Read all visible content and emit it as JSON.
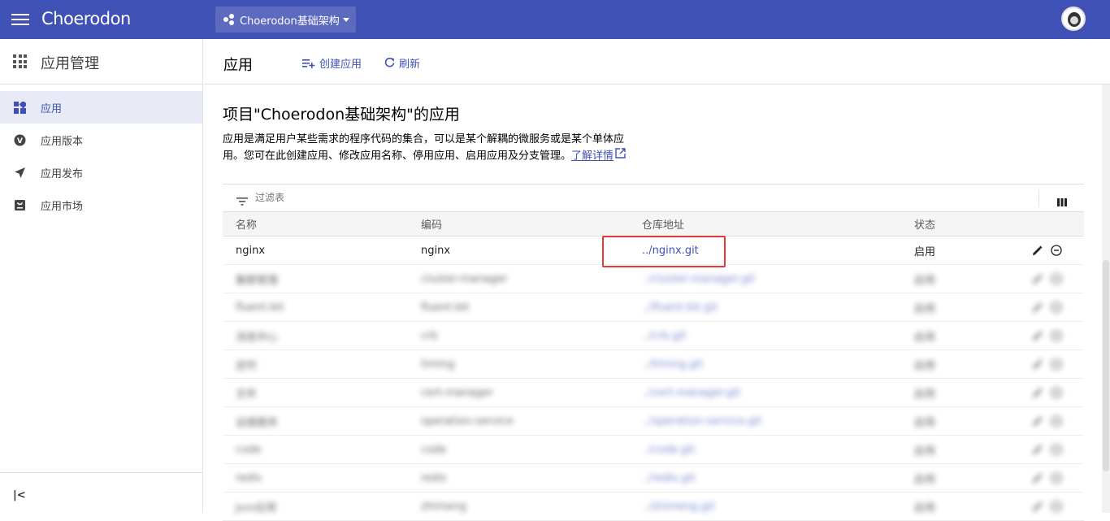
{
  "topbar": {
    "logo": "Choerodon",
    "project": "Choerodon基础架构"
  },
  "sidebar": {
    "title": "应用管理",
    "items": [
      {
        "label": "应用",
        "icon": "dashboard-icon",
        "active": true
      },
      {
        "label": "应用版本",
        "icon": "version-icon",
        "active": false
      },
      {
        "label": "应用发布",
        "icon": "send-icon",
        "active": false
      },
      {
        "label": "应用市场",
        "icon": "store-icon",
        "active": false
      }
    ]
  },
  "header": {
    "title": "应用",
    "create_label": "创建应用",
    "refresh_label": "刷新"
  },
  "main": {
    "heading": "项目\"Choerodon基础架构\"的应用",
    "description": "应用是满足用户某些需求的程序代码的集合，可以是某个解耦的微服务或是某个单体应用。您可在此创建应用、修改应用名称、停用应用、启用应用及分支管理。",
    "learn_more": "了解详情"
  },
  "filter": {
    "placeholder": "过滤表"
  },
  "table": {
    "columns": [
      "名称",
      "编码",
      "仓库地址",
      "状态"
    ],
    "rows": [
      {
        "name": "nginx",
        "code": "nginx",
        "repo": "../nginx.git",
        "status": "启用",
        "blurred": false
      },
      {
        "name": "集群管理",
        "code": "cluster-manager",
        "repo": "../cluster-manager.git",
        "status": "启用",
        "blurred": true
      },
      {
        "name": "fluent-bit",
        "code": "fluent-bit",
        "repo": "../fluent-bit.git",
        "status": "启用",
        "blurred": true
      },
      {
        "name": "消息中心",
        "code": "crb",
        "repo": "../crb.git",
        "status": "启用",
        "blurred": true
      },
      {
        "name": "定时",
        "code": "timing",
        "repo": "../timing.git",
        "status": "启用",
        "blurred": true
      },
      {
        "name": "文件",
        "code": "cert-manager",
        "repo": "../cert-manager.git",
        "status": "启用",
        "blurred": true
      },
      {
        "name": "运维服务",
        "code": "operation-service",
        "repo": "../operation-service.git",
        "status": "启用",
        "blurred": true
      },
      {
        "name": "code",
        "code": "code",
        "repo": "../code.git",
        "status": "启用",
        "blurred": true
      },
      {
        "name": "redis",
        "code": "redis",
        "repo": "../redis.git",
        "status": "启用",
        "blurred": true
      },
      {
        "name": "Jvm应用",
        "code": "zhimeng",
        "repo": "../zhimeng.git",
        "status": "启用",
        "blurred": true
      }
    ]
  },
  "colors": {
    "primary": "#3f51b5",
    "highlight": "#e53935"
  }
}
